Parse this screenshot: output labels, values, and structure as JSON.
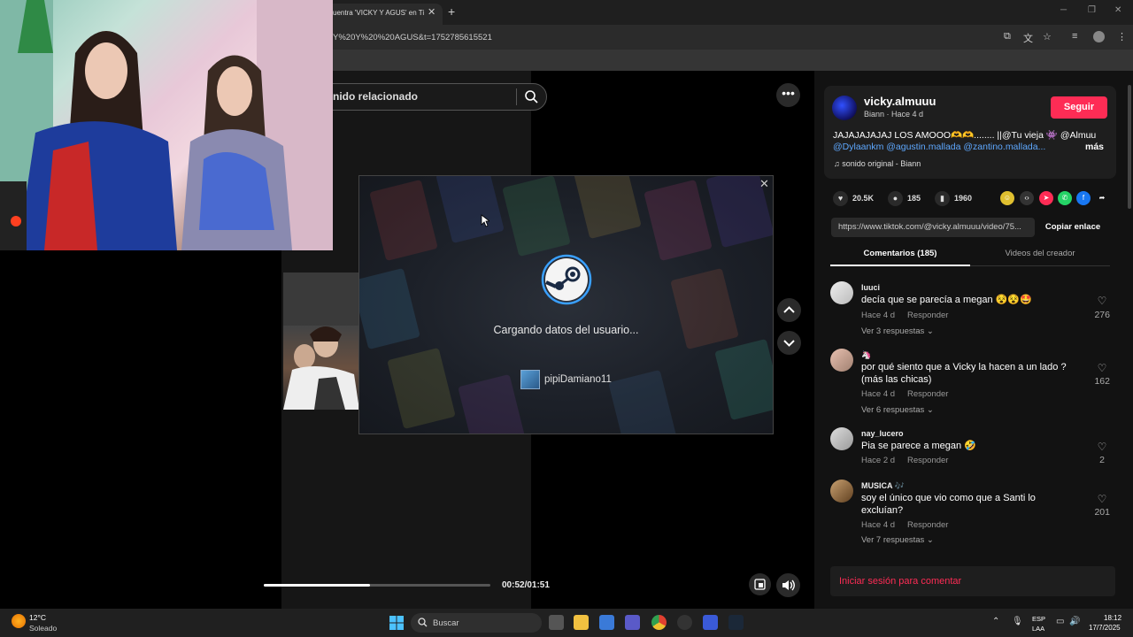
{
  "browser": {
    "tab_title": "uentra 'VICKY Y AGUS' en Ti",
    "url": "Y%20Y%20%20AGUS&t=1752785615521"
  },
  "video": {
    "search_text": "nido relacionado",
    "time": "00:52/01:51",
    "progress": 0.47
  },
  "steam": {
    "loading_text": "Cargando datos del usuario...",
    "username": "pipiDamiano11"
  },
  "post": {
    "author": "vicky.almuuu",
    "meta": "Biann · Hace 4 d",
    "follow_label": "Seguir",
    "desc_line1": "JAJAJAJAJAJ LOS AMOOO🫶🫶........ ||@Tu vieja 👾 @Almuu",
    "desc_line2": "@Dylaankm @agustin.mallada @zantino.mallada...",
    "more_label": "más",
    "sound": "♫  sonido original - Biann",
    "likes": "20.5K",
    "comments": "185",
    "saves": "1960",
    "link": "https://www.tiktok.com/@vicky.almuuu/video/75...",
    "copy_label": "Copiar enlace",
    "tab_comments": "Comentarios (185)",
    "tab_creator": "Videos del creador"
  },
  "comments": [
    {
      "user": "luuci",
      "text": "decía que se parecía a megan 😵😵🤩",
      "meta": "Hace 4 d",
      "reply": "Responder",
      "replies": "Ver 3 respuestas ⌄",
      "likes": "276"
    },
    {
      "user": "🦄",
      "text": "por qué siento que a Vicky la hacen a un lado ? (más las chicas)",
      "meta": "Hace 4 d",
      "reply": "Responder",
      "replies": "Ver 6 respuestas ⌄",
      "likes": "162"
    },
    {
      "user": "nay_lucero",
      "text": "Pia se parece a megan 🤣",
      "meta": "Hace 2 d",
      "reply": "Responder",
      "replies": "",
      "likes": "2"
    },
    {
      "user": "MUSICA 🎶",
      "text": "soy el único que vio como que a Santi lo excluían?",
      "meta": "Hace 4 d",
      "reply": "Responder",
      "replies": "Ver 7 respuestas ⌄",
      "likes": "201"
    }
  ],
  "login_text": "Iniciar sesión para comentar",
  "taskbar": {
    "temp": "12°C",
    "weather": "Soleado",
    "search": "Buscar",
    "lang1": "ESP",
    "lang2": "LAA",
    "time": "18:12",
    "date": "17/7/2025"
  }
}
